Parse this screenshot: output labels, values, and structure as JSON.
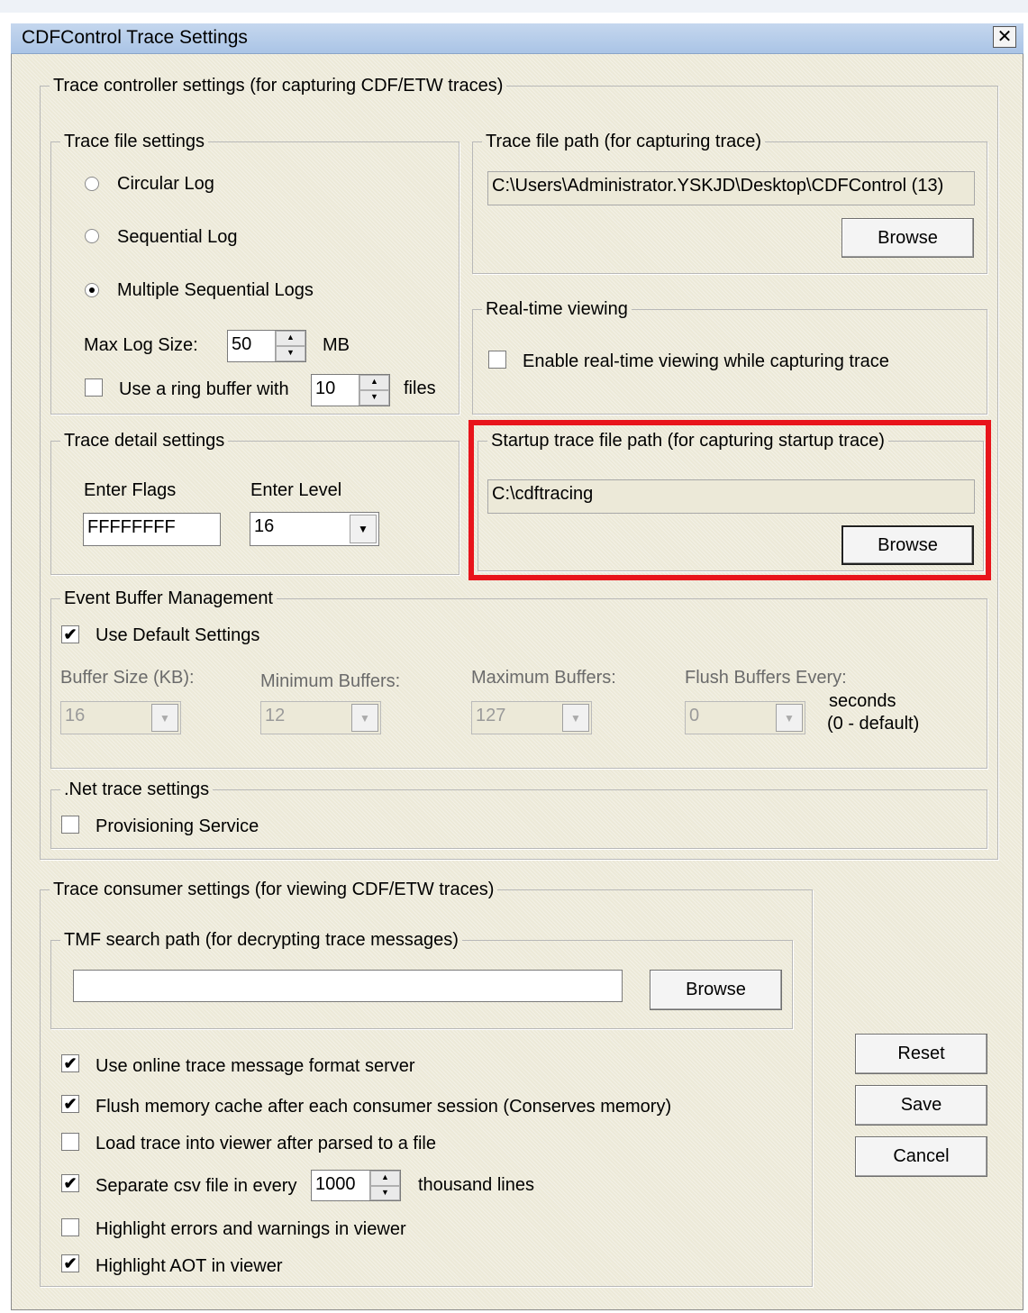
{
  "window": {
    "title": "CDFControl Trace Settings",
    "close_glyph": "✕"
  },
  "controller": {
    "legend": "Trace controller settings (for capturing CDF/ETW traces)",
    "file_settings": {
      "legend": "Trace file settings",
      "circular": "Circular Log",
      "sequential": "Sequential Log",
      "multiple": "Multiple Sequential Logs",
      "selected": "Multiple Sequential Logs",
      "max_log_label": "Max Log Size:",
      "max_log_value": "50",
      "max_log_unit": "MB",
      "ring_label": "Use a ring buffer with",
      "ring_value": "10",
      "ring_unit": "files",
      "ring_checked": false
    },
    "file_path": {
      "legend": "Trace file path (for capturing trace)",
      "value": "C:\\Users\\Administrator.YSKJD\\Desktop\\CDFControl (13)",
      "browse": "Browse"
    },
    "realtime": {
      "legend": "Real-time viewing",
      "label": "Enable real-time viewing while capturing trace",
      "checked": false
    },
    "detail": {
      "legend": "Trace detail settings",
      "flags_label": "Enter Flags",
      "flags_value": "FFFFFFFF",
      "level_label": "Enter Level",
      "level_value": "16"
    },
    "startup": {
      "legend": "Startup trace file path (for capturing startup trace)",
      "value": "C:\\cdftracing",
      "browse": "Browse"
    },
    "buffer": {
      "legend": "Event Buffer Management",
      "default_label": "Use Default Settings",
      "default_checked": true,
      "size_label": "Buffer Size (KB):",
      "size_value": "16",
      "min_label": "Minimum Buffers:",
      "min_value": "12",
      "max_label": "Maximum Buffers:",
      "max_value": "127",
      "flush_label": "Flush Buffers Every:",
      "flush_value": "0",
      "seconds": "seconds",
      "default_note": "(0 - default)"
    },
    "net": {
      "legend": ".Net trace settings",
      "provisioning": "Provisioning Service",
      "checked": false
    }
  },
  "consumer": {
    "legend": "Trace consumer settings (for viewing CDF/ETW traces)",
    "tmf": {
      "legend": "TMF search path (for decrypting trace messages)",
      "value": "",
      "browse": "Browse"
    },
    "options": {
      "online": "Use online trace message format server",
      "flush": "Flush memory cache after each consumer session (Conserves memory)",
      "load": "Load trace into viewer after parsed to a file",
      "separate": "Separate csv file in every",
      "separate_value": "1000",
      "separate_unit": "thousand lines",
      "highlight_errors": "Highlight errors and warnings in viewer",
      "highlight_aot": "Highlight AOT in viewer"
    },
    "checks": {
      "online": true,
      "flush": true,
      "load": false,
      "separate": true,
      "highlight_errors": false,
      "highlight_aot": true
    }
  },
  "buttons": {
    "reset": "Reset",
    "save": "Save",
    "cancel": "Cancel"
  },
  "glyphs": {
    "check": "✔",
    "spin_up": "▲",
    "spin_down": "▼",
    "combo_arrow": "▼"
  },
  "colors": {
    "highlight": "#e8141b"
  }
}
